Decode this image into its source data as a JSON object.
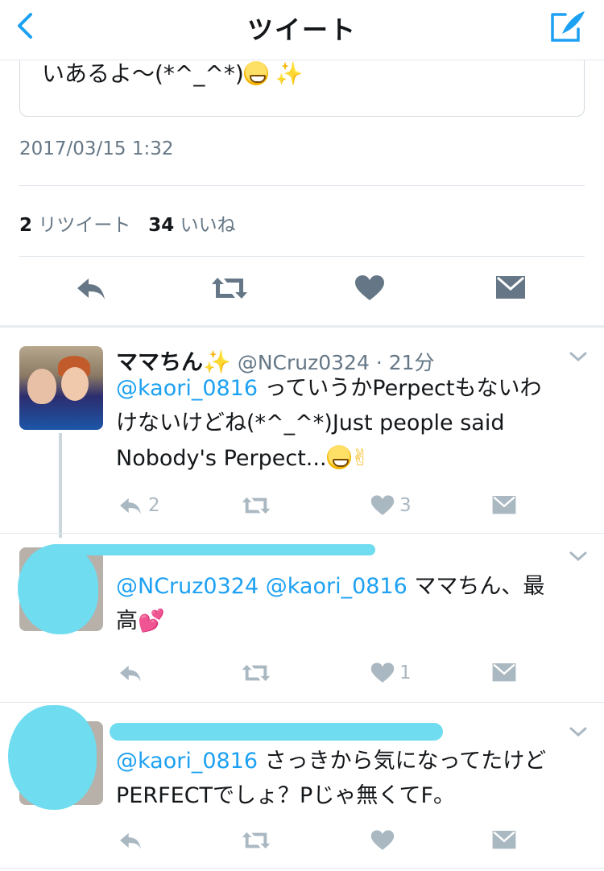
{
  "nav": {
    "title": "ツイート"
  },
  "tweet": {
    "text_tail": "いあるよ〜(*^_^*)",
    "timestamp": "2017/03/15 1:32",
    "retweet_count": "2",
    "retweet_label": "リツイート",
    "like_count": "34",
    "like_label": "いいね"
  },
  "replies": [
    {
      "name": "ママちん",
      "handle": "@NCruz0324",
      "time": "· 21分",
      "mention": "@kaori_0816",
      "line1": " っていうかPerpectもないわ",
      "line2": "けないけどね(*^_^*)Just people said",
      "line3": "Nobody's Perpect...",
      "reply_count": "2",
      "like_count": "3"
    },
    {
      "mention1": "@NCruz0324",
      "mention2": "@kaori_0816",
      "line1": " ママちん、最",
      "line2": "高",
      "like_count": "1"
    },
    {
      "mention": "@kaori_0816",
      "line1": " さっきから気になってたけど",
      "line2": "PERFECTでしょ？Pじゃ無くてF。"
    }
  ],
  "colors": {
    "accent": "#1da1f2",
    "muted": "#657786",
    "icon": "#aab8c2",
    "action_dark": "#657786"
  },
  "icons": [
    "back-chevron",
    "compose",
    "reply",
    "retweet",
    "heart",
    "dm-envelope",
    "dropdown-caret"
  ]
}
